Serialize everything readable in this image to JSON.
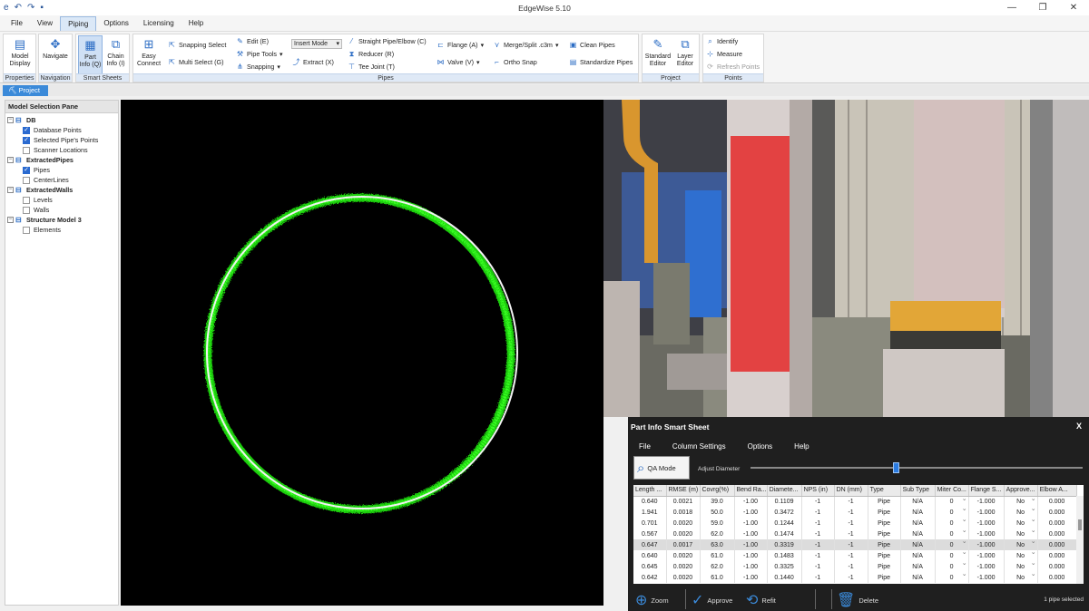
{
  "app": {
    "title": "EdgeWise 5.10",
    "quick_access": [
      "e",
      "↶",
      "↷",
      "▪"
    ],
    "win_controls": [
      "—",
      "❐",
      "✕"
    ]
  },
  "menu": [
    "File",
    "View",
    "Piping",
    "Options",
    "Licensing",
    "Help"
  ],
  "ribbon": {
    "properties": {
      "label": "Properties",
      "model_display": "Model Display"
    },
    "navigation": {
      "label": "Navigation",
      "navigate": "Navigate"
    },
    "smart_sheets": {
      "label": "Smart Sheets",
      "part_info": "Part Info (Q)",
      "chain_info": "Chain Info (I)"
    },
    "pipes": {
      "label": "Pipes",
      "easy_connect": "Easy Connect",
      "snapping_select": "Snapping Select",
      "multi_select": "Multi Select (G)",
      "edit": "Edit (E)",
      "pipe_tools": "Pipe Tools",
      "snapping": "Snapping",
      "insert_mode": "Insert Mode",
      "extract": "Extract (X)",
      "straight_pipe": "Straight Pipe/Elbow (C)",
      "reducer": "Reducer (R)",
      "tee_joint": "Tee Joint (T)",
      "flange": "Flange (A)",
      "valve": "Valve (V)",
      "merge_split": "Merge/Split .c3m",
      "ortho_snap": "Ortho Snap",
      "clean_pipes": "Clean Pipes",
      "standardize_pipes": "Standardize Pipes"
    },
    "project": {
      "label": "Project",
      "standard_editor": "Standard Editor",
      "layer_editor": "Layer Editor"
    },
    "points": {
      "label": "Points",
      "identify": "Identify",
      "measure": "Measure",
      "refresh_points": "Refresh Points"
    }
  },
  "doc_tab": "Project",
  "left_pane": {
    "title": "Model Selection Pane",
    "tree": [
      {
        "label": "DB",
        "children": [
          {
            "label": "Database Points",
            "checked": true
          },
          {
            "label": "Selected Pipe's Points",
            "checked": true
          },
          {
            "label": "Scanner Locations",
            "checked": false
          }
        ]
      },
      {
        "label": "ExtractedPipes",
        "children": [
          {
            "label": "Pipes",
            "checked": true
          },
          {
            "label": "CenterLines",
            "checked": false
          }
        ]
      },
      {
        "label": "ExtractedWalls",
        "children": [
          {
            "label": "Levels",
            "checked": false
          },
          {
            "label": "Walls",
            "checked": false
          }
        ]
      },
      {
        "label": "Structure Model 3",
        "children": [
          {
            "label": "Elements",
            "checked": false
          }
        ]
      }
    ]
  },
  "smart_sheet": {
    "title": "Part Info Smart Sheet",
    "close": "X",
    "menu": [
      "File",
      "Column Settings",
      "Options",
      "Help"
    ],
    "qa_mode": "QA Mode",
    "adjust_diameter": "Adjust Diameter",
    "slider_fraction": 0.43,
    "columns": [
      "Length ...",
      "RMSE (m)",
      "Covrg(%)",
      "Bend Ra...",
      "Diamete...",
      "NPS (in)",
      "DN (mm)",
      "Type",
      "Sub Type",
      "Miter Co...",
      "Flange S...",
      "Approve...",
      "Elbow A..."
    ],
    "rows": [
      [
        "0.640",
        "0.0021",
        "39.0",
        "-1.00",
        "0.1109",
        "-1",
        "-1",
        "Pipe",
        "N/A",
        "0",
        "-1.000",
        "No",
        "0.000"
      ],
      [
        "1.941",
        "0.0018",
        "50.0",
        "-1.00",
        "0.3472",
        "-1",
        "-1",
        "Pipe",
        "N/A",
        "0",
        "-1.000",
        "No",
        "0.000"
      ],
      [
        "0.701",
        "0.0020",
        "59.0",
        "-1.00",
        "0.1244",
        "-1",
        "-1",
        "Pipe",
        "N/A",
        "0",
        "-1.000",
        "No",
        "0.000"
      ],
      [
        "0.567",
        "0.0020",
        "62.0",
        "-1.00",
        "0.1474",
        "-1",
        "-1",
        "Pipe",
        "N/A",
        "0",
        "-1.000",
        "No",
        "0.000"
      ],
      [
        "0.647",
        "0.0017",
        "63.0",
        "-1.00",
        "0.3319",
        "-1",
        "-1",
        "Pipe",
        "N/A",
        "0",
        "-1.000",
        "No",
        "0.000"
      ],
      [
        "0.640",
        "0.0020",
        "61.0",
        "-1.00",
        "0.1483",
        "-1",
        "-1",
        "Pipe",
        "N/A",
        "0",
        "-1.000",
        "No",
        "0.000"
      ],
      [
        "0.645",
        "0.0020",
        "62.0",
        "-1.00",
        "0.3325",
        "-1",
        "-1",
        "Pipe",
        "N/A",
        "0",
        "-1.000",
        "No",
        "0.000"
      ],
      [
        "0.642",
        "0.0020",
        "61.0",
        "-1.00",
        "0.1440",
        "-1",
        "-1",
        "Pipe",
        "N/A",
        "0",
        "-1.000",
        "No",
        "0.000"
      ]
    ],
    "highlighted_row": 4,
    "actions": {
      "zoom": "Zoom",
      "approve": "Approve",
      "refit": "Refit",
      "delete": "Delete"
    },
    "status": "1 pipe selected"
  },
  "colors": {
    "accent": "#3b8ad9",
    "point_cloud": "#22dd11",
    "pipe_red": "#e83c3c",
    "pipe_orange": "#e0a030"
  }
}
